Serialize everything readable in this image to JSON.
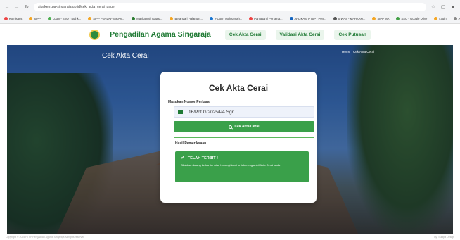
{
  "browser": {
    "url": "sipakem.pa-singaraja.go.id/cek_acta_cerai_page",
    "bookmarks": [
      {
        "label": "Komisaris",
        "color": "#e44"
      },
      {
        "label": "SIPP",
        "color": "#f5a623"
      },
      {
        "label": "Login - SSO - Mahk...",
        "color": "#4caf50"
      },
      {
        "label": "SIPP PENDAFTARAN...",
        "color": "#f5a623"
      },
      {
        "label": "Mahkamah Agung...",
        "color": "#2e7d32"
      },
      {
        "label": "Beranda | Halaman...",
        "color": "#f5a623"
      },
      {
        "label": "e-Court Mahkamah...",
        "color": "#1976d2"
      },
      {
        "label": "Panjaitan | Perserta...",
        "color": "#e44"
      },
      {
        "label": "APLIKASI PTSP | Pen...",
        "color": "#1565c0"
      },
      {
        "label": "SIWAS - MAHKAM...",
        "color": "#555"
      },
      {
        "label": "SIPP MA",
        "color": "#f5a623"
      },
      {
        "label": "SSO - Google Drive",
        "color": "#43a047"
      },
      {
        "label": "Login",
        "color": "#f5a623"
      },
      {
        "label": "All Bookm",
        "color": "#888"
      }
    ]
  },
  "site": {
    "brand": "Pengadilan Agama Singaraja",
    "nav": [
      "Cek Akta Cerai",
      "Validasi Akta Cerai",
      "Cek Putusan"
    ]
  },
  "hero": {
    "title": "Cek Akta Cerai",
    "breadcrumb": [
      "Home",
      "Cek Akta Cerai"
    ]
  },
  "card": {
    "title": "Cek Akta Cerai",
    "field_label": "Masukan Nomor Perkara",
    "input_value": "16/Pdt.G/2025/PA.Sgr",
    "button_label": "Cek Akta Cerai",
    "result_heading": "Hasil Pemeriksaan",
    "alert_title": "TELAH TERBIT !",
    "alert_body": "Silahkan datang ke kantor atau hubungi kami untuk mengambil Akta Cerai anda"
  },
  "footer": {
    "left": "Copyright © 2025 PTSP Pengadilan Agama Singaraja All rights reserved",
    "right": "By: Sudipa Design"
  }
}
